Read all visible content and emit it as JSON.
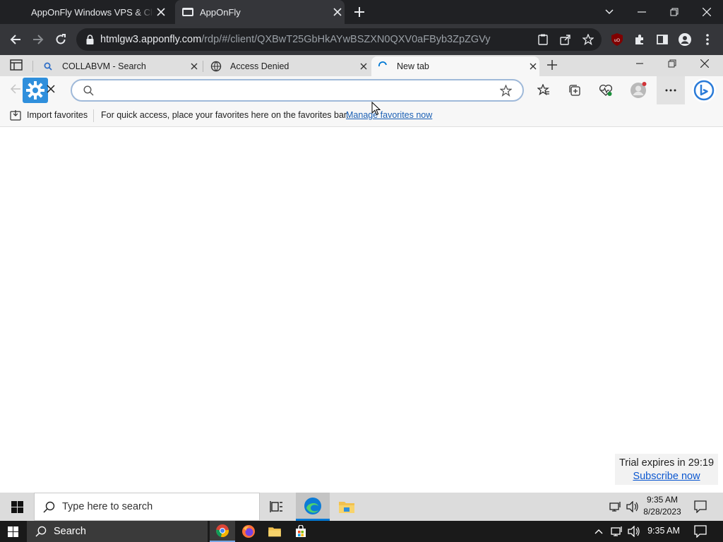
{
  "host_browser": {
    "tabs": [
      {
        "title": "AppOnFly Windows VPS & Cloud"
      },
      {
        "title": "AppOnFly"
      }
    ],
    "url_domain": "htmlgw3.apponfly.com",
    "url_path": "/rdp/#/client/QXBwT25GbHkAYwBSZXN0QXV0aFByb3ZpZGVy"
  },
  "edge_browser": {
    "tabs": [
      {
        "title": "COLLABVM - Search",
        "icon": "search-icon"
      },
      {
        "title": "Access Denied",
        "icon": "globe-icon"
      },
      {
        "title": "New tab",
        "icon": "loading-spinner-icon",
        "active": true
      }
    ],
    "address_placeholder": "",
    "address_value": "",
    "favorites_bar": {
      "import_label": "Import favorites",
      "message": "For quick access, place your favorites here on the favorites bar.",
      "link_label": "Manage favorites now"
    }
  },
  "trial_badge": {
    "text": "Trial expires in 29:19",
    "link": "Subscribe now"
  },
  "remote_taskbar": {
    "search_placeholder": "Type here to search",
    "time": "9:35 AM",
    "date": "8/28/2023"
  },
  "host_taskbar": {
    "search_label": "Search",
    "time": "9:35 AM"
  },
  "colors": {
    "host_dark": "#202124",
    "host_toolbar": "#35363a",
    "edge_accent": "#0078d4",
    "link_blue": "#1a5fb4"
  }
}
